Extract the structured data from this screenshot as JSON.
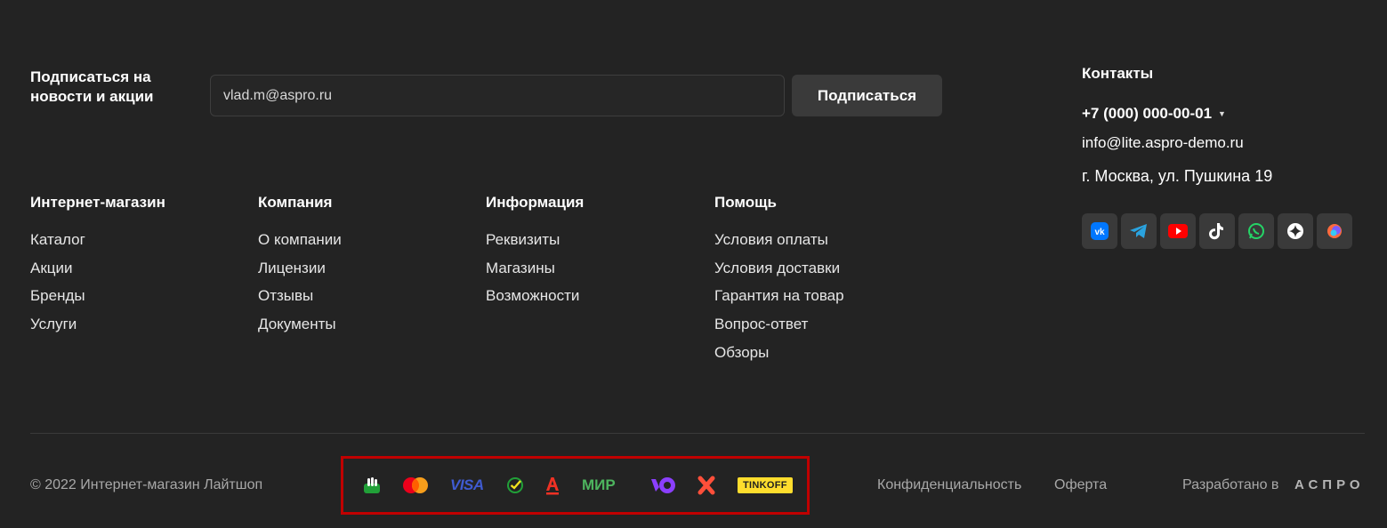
{
  "subscribe": {
    "title": "Подписаться на новости и акции",
    "email_value": "vlad.m@aspro.ru",
    "button_label": "Подписаться"
  },
  "contacts": {
    "title": "Контакты",
    "phone": "+7 (000) 000-00-01",
    "email": "info@lite.aspro-demo.ru",
    "address": "г. Москва, ул. Пушкина 19",
    "socials": [
      "vk-icon",
      "telegram-icon",
      "youtube-icon",
      "tiktok-icon",
      "whatsapp-icon",
      "zen-icon",
      "odnoklassniki-icon"
    ]
  },
  "menus": [
    {
      "title": "Интернет-магазин",
      "items": [
        "Каталог",
        "Акции",
        "Бренды",
        "Услуги"
      ]
    },
    {
      "title": "Компания",
      "items": [
        "О компании",
        "Лицензии",
        "Отзывы",
        "Документы"
      ]
    },
    {
      "title": "Информация",
      "items": [
        "Реквизиты",
        "Магазины",
        "Возможности"
      ]
    },
    {
      "title": "Помощь",
      "items": [
        "Условия оплаты",
        "Условия доставки",
        "Гарантия на товар",
        "Вопрос-ответ",
        "Обзоры"
      ]
    }
  ],
  "footer": {
    "copyright": "© 2022 Интернет-магазин Лайтшоп",
    "payments": {
      "visa": "VISA",
      "mir": "МИР",
      "tinkoff": "TINKOFF"
    },
    "privacy": "Конфиденциальность",
    "offer": "Оферта",
    "developed_by": "Разработано в",
    "developer": "АСПРО"
  },
  "colors": {
    "background": "#232323",
    "highlight_border": "#c00000",
    "vk": "#0077ff",
    "telegram": "#2aa3df",
    "youtube": "#ff0000",
    "whatsapp": "#25d366",
    "tinkoff_yellow": "#ffdd2d"
  }
}
